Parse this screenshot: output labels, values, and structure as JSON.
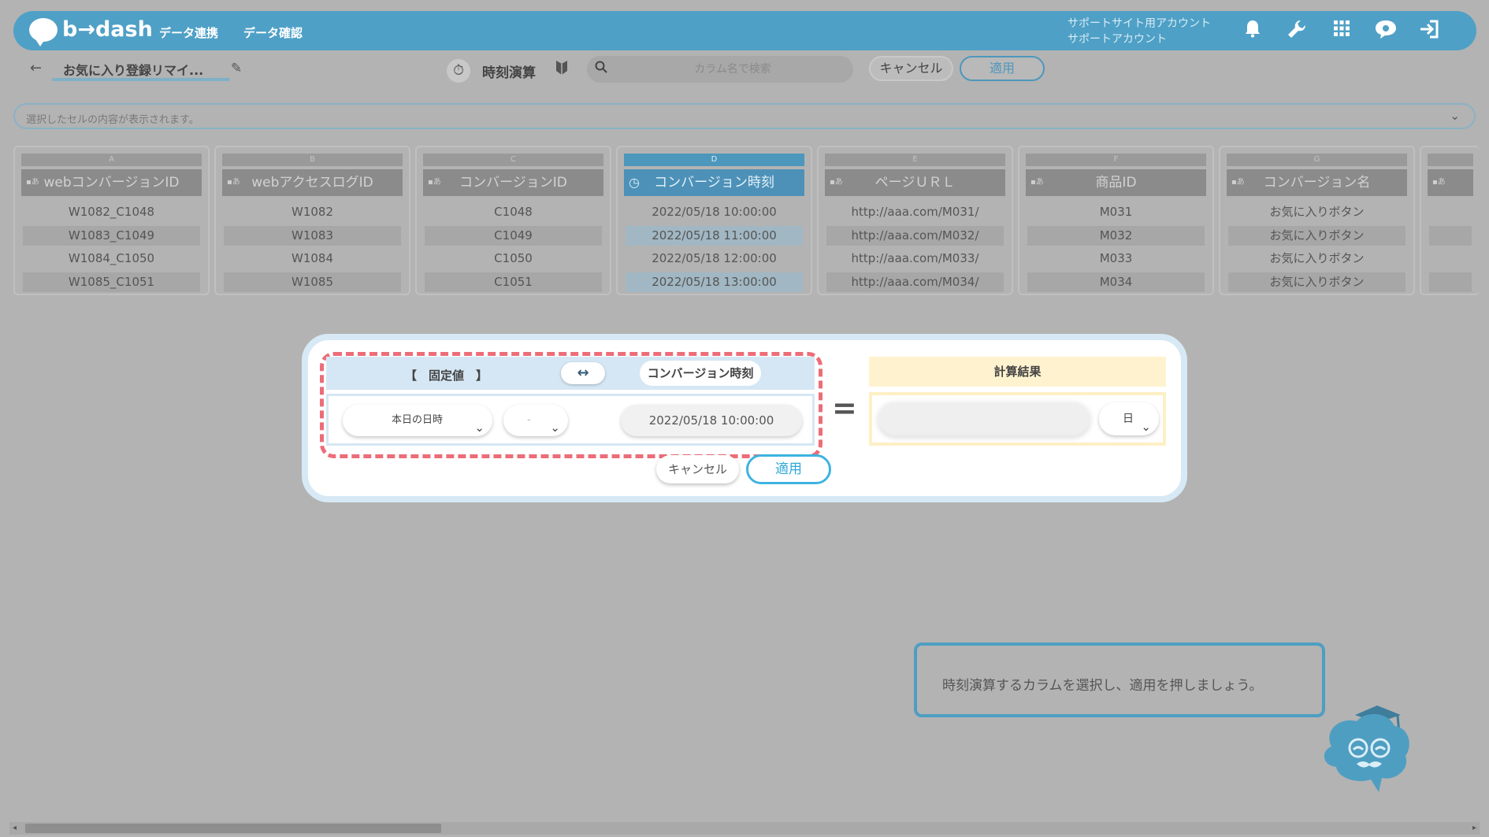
{
  "app": {
    "logo_text": "b→dash",
    "nav": [
      "データ連携",
      "データ確認"
    ],
    "account_line1": "サポートサイト用アカウント",
    "account_line2": "サポートアカウント"
  },
  "toolbar": {
    "back": "←",
    "title": "お気に入り登録リマイ...",
    "mode_label": "時刻演算",
    "search_placeholder": "カラム名で検索",
    "cancel_label": "キャンセル",
    "apply_label": "適用"
  },
  "cell_bar": {
    "placeholder": "選択したセルの内容が表示されます。"
  },
  "columns": [
    {
      "letter": "A",
      "type": "▪あ",
      "header": "webコンバージョンID",
      "cells": [
        "W1082_C1048",
        "W1083_C1049",
        "W1084_C1050",
        "W1085_C1051"
      ]
    },
    {
      "letter": "B",
      "type": "▪あ",
      "header": "webアクセスログID",
      "cells": [
        "W1082",
        "W1083",
        "W1084",
        "W1085"
      ]
    },
    {
      "letter": "C",
      "type": "▪あ",
      "header": "コンバージョンID",
      "cells": [
        "C1048",
        "C1049",
        "C1050",
        "C1051"
      ]
    },
    {
      "letter": "D",
      "type": "◷",
      "header": "コンバージョン時刻",
      "cells": [
        "2022/05/18 10:00:00",
        "2022/05/18 11:00:00",
        "2022/05/18 12:00:00",
        "2022/05/18 13:00:00"
      ]
    },
    {
      "letter": "E",
      "type": "▪あ",
      "header": "ページＵＲＬ",
      "cells": [
        "http://aaa.com/M031/",
        "http://aaa.com/M032/",
        "http://aaa.com/M033/",
        "http://aaa.com/M034/"
      ]
    },
    {
      "letter": "F",
      "type": "▪あ",
      "header": "商品ID",
      "cells": [
        "M031",
        "M032",
        "M033",
        "M034"
      ]
    },
    {
      "letter": "G",
      "type": "▪あ",
      "header": "コンバージョン名",
      "cells": [
        "お気に入りボタン",
        "お気に入りボタン",
        "お気に入りボタン",
        "お気に入りボタン"
      ]
    },
    {
      "letter": "",
      "type": "▪あ",
      "header": "",
      "cells": [
        "",
        "",
        "",
        ""
      ]
    }
  ],
  "dialog": {
    "fixed_label": "【　固定値　】",
    "swap": "↔",
    "column_label": "コンバージョン時刻",
    "fixed_select": "本日の日時",
    "operator_select": "-",
    "date_value": "2022/05/18 10:00:00",
    "equals": "=",
    "result_header": "計算結果",
    "result_unit": "日",
    "cancel_label": "キャンセル",
    "apply_label": "適用"
  },
  "hint": {
    "text": "時刻演算するカラムを選択し、適用を押しましょう。"
  },
  "colors": {
    "brand": "#4fa0c6",
    "active_column": "#4d91b8",
    "dashed_highlight": "#ec6d78",
    "apply_border": "#3db3e0"
  }
}
